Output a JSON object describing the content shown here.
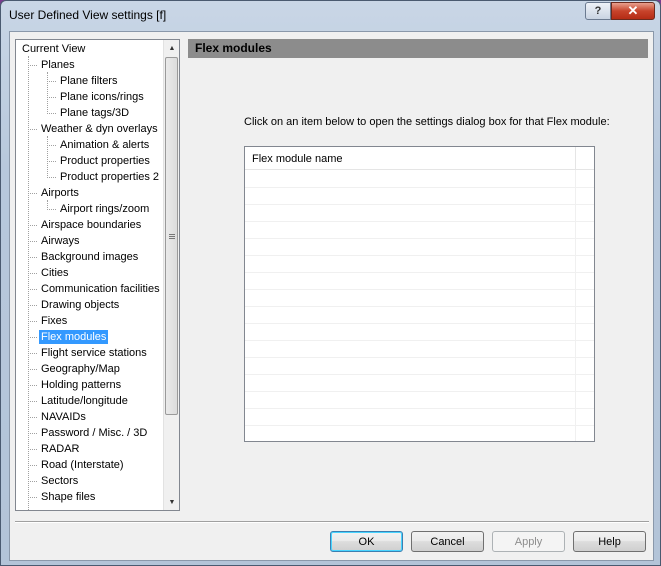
{
  "window": {
    "title": "User Defined View settings  [f]",
    "help_glyph": "?",
    "close_glyph": "✕"
  },
  "tree": {
    "items": [
      {
        "label": "Current View",
        "level": 0
      },
      {
        "label": "Planes",
        "level": 1
      },
      {
        "label": "Plane filters",
        "level": 2
      },
      {
        "label": "Plane icons/rings",
        "level": 2
      },
      {
        "label": "Plane tags/3D",
        "level": 2
      },
      {
        "label": "Weather & dyn overlays",
        "level": 1
      },
      {
        "label": "Animation & alerts",
        "level": 2
      },
      {
        "label": "Product properties",
        "level": 2
      },
      {
        "label": "Product properties 2",
        "level": 2
      },
      {
        "label": "Airports",
        "level": 1
      },
      {
        "label": "Airport rings/zoom",
        "level": 2
      },
      {
        "label": "Airspace boundaries",
        "level": 1
      },
      {
        "label": "Airways",
        "level": 1
      },
      {
        "label": "Background images",
        "level": 1
      },
      {
        "label": "Cities",
        "level": 1
      },
      {
        "label": "Communication facilities",
        "level": 1
      },
      {
        "label": "Drawing objects",
        "level": 1
      },
      {
        "label": "Fixes",
        "level": 1
      },
      {
        "label": "Flex modules",
        "level": 1,
        "selected": true
      },
      {
        "label": "Flight service stations",
        "level": 1
      },
      {
        "label": "Geography/Map",
        "level": 1
      },
      {
        "label": "Holding patterns",
        "level": 1
      },
      {
        "label": "Latitude/longitude",
        "level": 1
      },
      {
        "label": "NAVAIDs",
        "level": 1
      },
      {
        "label": "Password / Misc. / 3D",
        "level": 1
      },
      {
        "label": "RADAR",
        "level": 1
      },
      {
        "label": "Road (Interstate)",
        "level": 1
      },
      {
        "label": "Sectors",
        "level": 1
      },
      {
        "label": "Shape files",
        "level": 1
      }
    ]
  },
  "panel": {
    "header": "Flex modules",
    "instruction": "Click on an item below to open the settings dialog box for that Flex module:",
    "list_column": "Flex module name",
    "rows": []
  },
  "buttons": {
    "ok": "OK",
    "cancel": "Cancel",
    "apply": "Apply",
    "help": "Help"
  },
  "scrollbar": {
    "up_glyph": "▲",
    "down_glyph": "▼"
  }
}
